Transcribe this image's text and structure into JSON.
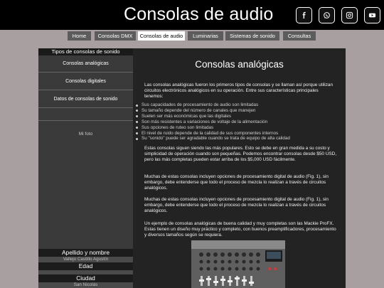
{
  "header": {
    "title": "Consolas de audio",
    "social": [
      {
        "icon": "facebook-icon"
      },
      {
        "icon": "whatsapp-icon"
      },
      {
        "icon": "instagram-icon"
      },
      {
        "icon": "youtube-icon"
      }
    ]
  },
  "nav": {
    "items": [
      {
        "label": "Home"
      },
      {
        "label": "Consolas DMX"
      },
      {
        "label": "Consolas de audio"
      },
      {
        "label": "Luminarias"
      },
      {
        "label": "Sistemas de sonido"
      },
      {
        "label": "Consultas"
      }
    ],
    "active": "Consolas de audio"
  },
  "sidebar": {
    "title": "Tipos de consolas de sonido",
    "links": [
      {
        "label": "Consolas analógicas"
      },
      {
        "label": "Consolas digitales"
      },
      {
        "label": "Datos de consolas de sonido"
      }
    ],
    "photo_label": "Mi foto",
    "fields": [
      {
        "label": "Apellido y nombre",
        "value": "Vallejo Castillo Agustín"
      },
      {
        "label": "Edad",
        "value": ""
      },
      {
        "label": "Ciudad",
        "value": "San Nicolás"
      }
    ]
  },
  "main": {
    "title": "Consolas analógicas",
    "intro": "Las consolas analógicas fueron los primeros tipos de consolas y se llaman así porque utilizan circuitos electrónicos analógicos en su operación. Entre sus características principales tenemos:",
    "bullets": [
      "Sus capacidades de procesamiento de audio son limitadas",
      "Su tamaño depende del número de canales que manejen",
      "Suelen ser más económicas que las digitales",
      "Son más resistentes a variaciones de voltaje de la alimentación",
      "Sus opciones de ruteo son limitadas",
      "El nivel de ruido depende de la calidad de sus componentes internos",
      "Su \"sonido\" puede ser agradable cuando se trata de equipo de alta calidad"
    ],
    "paragraphs": [
      "Estas consolas siguen siendo las más populares. Esto se debe en gran medida a su costo y simplicidad de operación cuando son pequeñas. Podemos encontrar consolas desde $50 USD, pero las más completas pueden estar arriba de los $5,000 USD fácilmente.",
      "Muchas de estas consolas incluyen opciones de procesamiento digital de audio (Fig. 1), sin embargo, debe entenderse que todo el proceso de mezcla lo realizan a través de circuitos analógicos.",
      "Muchas de estas consolas incluyen opciones de procesamiento digital de audio (Fig. 1), sin embargo, debe entenderse que todo el proceso de mezcla lo realizan a través de circuitos analógicos.",
      "Un ejemplo de consolas analógicas de buena calidad y muy completas son las Mackie ProFX. Estas tienen un diseño muy práctico y completo, con buenos preamplificadores, procesamiento y diversos tamaños según se requiera."
    ]
  }
}
